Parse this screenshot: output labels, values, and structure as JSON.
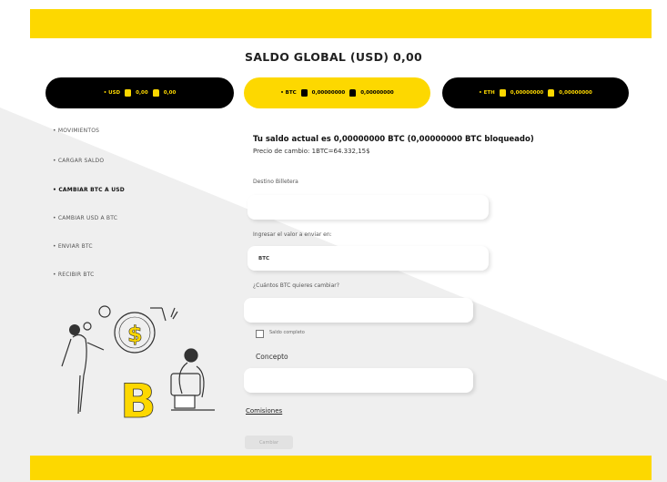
{
  "header": {
    "title": "SALDO GLOBAL (USD) 0,00"
  },
  "wallets": [
    {
      "label": "• USD",
      "amount": "0,00",
      "locked": "0,00",
      "active": false
    },
    {
      "label": "• BTC",
      "amount": "0,00000000",
      "locked": "0,00000000",
      "active": true
    },
    {
      "label": "• ETH",
      "amount": "0,00000000",
      "locked": "0,00000000",
      "active": false
    }
  ],
  "sidebar": {
    "items": [
      {
        "label": "• MOVIMIENTOS"
      },
      {
        "label": "• CARGAR SALDO"
      },
      {
        "label": "• CAMBIAR BTC A USD",
        "active": true
      },
      {
        "label": "• CAMBIAR USD A BTC"
      },
      {
        "label": "• ENVIAR BTC"
      },
      {
        "label": "• RECIBIR BTC"
      }
    ]
  },
  "main": {
    "balance_text": "Tu saldo actual es 0,00000000 BTC (0,00000000 BTC bloqueado)",
    "rate_text": "Precio de cambio: 1BTC=64.332,15$",
    "destino_label": "Destino Billetera",
    "destino_value": "",
    "ingresar_label": "Ingresar el valor a enviar en:",
    "ingresar_value": "BTC",
    "cuantos_label": "¿Cuántos BTC quieres cambiar?",
    "cuantos_value": "",
    "saldo_completo_label": "Saldo completo",
    "concepto_label": "Concepto",
    "concepto_value": "",
    "comisiones_label": "Comisiones",
    "submit_label": "Cambiar"
  },
  "colors": {
    "brand_yellow": "#fdd800",
    "dark": "#000000",
    "wedge": "#efefef"
  },
  "icons": [
    "wallet-icon",
    "lock-icon",
    "bitcoin-illustration"
  ]
}
